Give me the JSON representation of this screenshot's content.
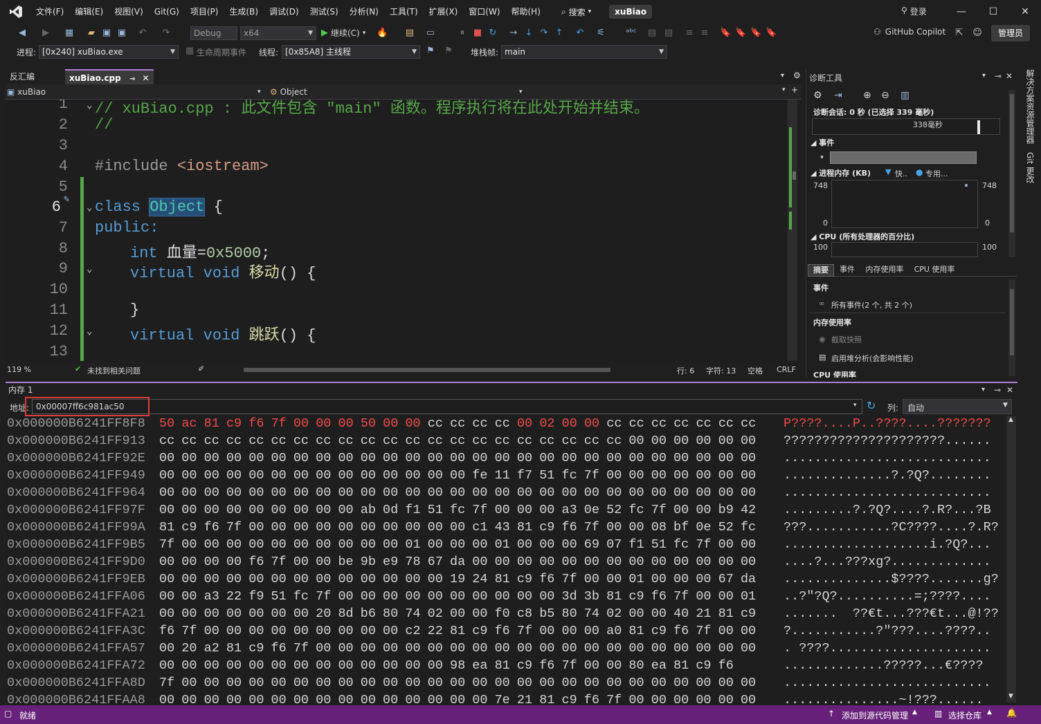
{
  "menu": [
    "文件(F)",
    "编辑(E)",
    "视图(V)",
    "Git(G)",
    "项目(P)",
    "生成(B)",
    "调试(D)",
    "测试(S)",
    "分析(N)",
    "工具(T)",
    "扩展(X)",
    "窗口(W)",
    "帮助(H)"
  ],
  "search_label": "搜索",
  "solution_name": "xuBiao",
  "login_label": "登录",
  "toolbar": {
    "config": "Debug",
    "platform": "x64",
    "continue_label": "继续(C)",
    "copilot_label": "GitHub Copilot",
    "admin_label": "管理员"
  },
  "debugbar": {
    "process_label": "进程:",
    "process_value": "[0x240] xuBiao.exe",
    "lifecycle_label": "生命周期事件",
    "thread_label": "线程:",
    "thread_value": "[0x85A8] 主线程",
    "stack_label": "堆栈帧:",
    "stack_value": "main"
  },
  "editor": {
    "tabs": [
      {
        "label": "反汇编",
        "active": false
      },
      {
        "label": "xuBiao.cpp",
        "active": true
      }
    ],
    "nav_left": "xuBiao",
    "nav_right": "Object",
    "line_numbers": [
      "1",
      "2",
      "3",
      "4",
      "5",
      "6",
      "7",
      "8",
      "9",
      "10",
      "11",
      "12",
      "13"
    ],
    "lines": {
      "l1": "// xuBiao.cpp : 此文件包含 \"main\" 函数。程序执行将在此处开始并结束。",
      "l2": "//",
      "l4a": "#include ",
      "l4b": "<iostream>",
      "l6a": "class ",
      "l6b": "Object",
      "l6c": " {",
      "l7": "public:",
      "l8a": "int",
      "l8b": " 血量=",
      "l8c": "0x5000",
      "l8d": ";",
      "l9a": "virtual",
      "l9b": " void",
      "l9c": " 移动",
      "l9d": "() {",
      "l11": "}",
      "l12a": "virtual",
      "l12b": " void",
      "l12c": " 跳跃",
      "l12d": "() {"
    },
    "zoom": "119 %",
    "issues": "未找到相关问题",
    "row": "行: 6",
    "col": "字符: 13",
    "spaces": "空格",
    "eol": "CRLF"
  },
  "diagnostics": {
    "title": "诊断工具",
    "session": "诊断会话: 0 秒 (已选择 339 毫秒)",
    "timeline_label": "338毫秒",
    "events_title": "事件",
    "memory_title": "进程内存 (KB)",
    "legend_fast": "快..",
    "legend_private": "专用...",
    "mem_max": "748",
    "mem_min": "0",
    "mem_max_r": "748",
    "mem_min_r": "0",
    "cpu_title": "CPU (所有处理器的百分比)",
    "cpu_max": "100",
    "cpu_max_r": "100",
    "tabs": [
      "摘要",
      "事件",
      "内存使用率",
      "CPU 使用率"
    ],
    "summary_events_title": "事件",
    "all_events": "所有事件(2 个, 共 2 个)",
    "mem_usage_title": "内存使用率",
    "snapshot": "截取快照",
    "heap_analysis": "启用堆分析(会影响性能)",
    "cpu_usage_title": "CPU 使用率"
  },
  "vtabs": [
    "解决方案资源管理器",
    "Git 更改"
  ],
  "memory": {
    "title": "内存 1",
    "addr_label": "地址:",
    "addr_value": "0x00007ff6c981ac50",
    "col_label": "列:",
    "col_value": "自动",
    "rows": [
      {
        "addr": "0x000000B6241FF8F8",
        "hex": "50 ac 81 c9 f6 7f 00 00 00 50 00 00 cc cc cc cc 00 02 00 00 cc cc cc cc cc cc cc",
        "ascii": "P????....P..????....???????"
      },
      {
        "addr": "0x000000B6241FF913",
        "hex": "cc cc cc cc cc cc cc cc cc cc cc cc cc cc cc cc cc cc cc cc cc 00 00 00 00 00 00",
        "ascii": "?????????????????????......"
      },
      {
        "addr": "0x000000B6241FF92E",
        "hex": "00 00 00 00 00 00 00 00 00 00 00 00 00 00 00 00 00 00 00 00 00 00 00 00 00 00 00",
        "ascii": "..........................."
      },
      {
        "addr": "0x000000B6241FF949",
        "hex": "00 00 00 00 00 00 00 00 00 00 00 00 00 00 fe 11 f7 51 fc 7f 00 00 00 00 00 00 00",
        "ascii": "..............?.?Q?........"
      },
      {
        "addr": "0x000000B6241FF964",
        "hex": "00 00 00 00 00 00 00 00 00 00 00 00 00 00 00 00 00 00 00 00 00 00 00 00 00 00 00",
        "ascii": "..........................."
      },
      {
        "addr": "0x000000B6241FF97F",
        "hex": "00 00 00 00 00 00 00 00 00 ab 0d f1 51 fc 7f 00 00 00 a3 0e 52 fc 7f 00 00 b9 42",
        "ascii": ".........?.?Q?....?.R?...?B"
      },
      {
        "addr": "0x000000B6241FF99A",
        "hex": "81 c9 f6 7f 00 00 00 00 00 00 00 00 00 00 c1 43 81 c9 f6 7f 00 00 08 bf 0e 52 fc",
        "ascii": "???...........?C????....?.R?"
      },
      {
        "addr": "0x000000B6241FF9B5",
        "hex": "7f 00 00 00 00 00 00 00 00 00 00 01 00 00 00 01 00 00 00 69 07 f1 51 fc 7f 00 00",
        "ascii": "...................i.?Q?..."
      },
      {
        "addr": "0x000000B6241FF9D0",
        "hex": "00 00 00 00 f6 7f 00 00 be 9b e9 78 67 da 00 00 00 00 00 00 00 00 00 00 00 00 00",
        "ascii": "....?...???xg?............."
      },
      {
        "addr": "0x000000B6241FF9EB",
        "hex": "00 00 00 00 00 00 00 00 00 00 00 00 00 19 24 81 c9 f6 7f 00 00 01 00 00 00 67 da",
        "ascii": "..............$????.......g?"
      },
      {
        "addr": "0x000000B6241FFA06",
        "hex": "00 00 a3 22 f9 51 fc 7f 00 00 00 00 00 00 00 00 00 00 3d 3b 81 c9 f6 7f 00 00 01",
        "ascii": "..?\"?Q?..........=;????...."
      },
      {
        "addr": "0x000000B6241FFA21",
        "hex": "00 00 00 00 00 00 00 20 8d b6 80 74 02 00 00 f0 c8 b5 80 74 02 00 00 40 21 81 c9",
        "ascii": ".......  ??€t...???€t...@!??"
      },
      {
        "addr": "0x000000B6241FFA3C",
        "hex": "f6 7f 00 00 00 00 00 00 00 00 00 c2 22 81 c9 f6 7f 00 00 00 a0 81 c9 f6 7f 00 00",
        "ascii": "?...........?\"???....????.."
      },
      {
        "addr": "0x000000B6241FFA57",
        "hex": "00 20 a2 81 c9 f6 7f 00 00 00 00 00 00 00 00 00 00 00 00 00 00 00 00 00 00 00 00",
        "ascii": ". ????....................."
      },
      {
        "addr": "0x000000B6241FFA72",
        "hex": "00 00 00 00 00 00 00 00 00 00 00 00 00 98 ea 81 c9 f6 7f 00 00 80 ea 81 c9 f6",
        "ascii": ".............?????...€????"
      },
      {
        "addr": "0x000000B6241FFA8D",
        "hex": "7f 00 00 00 00 00 00 00 00 00 00 00 00 00 00 00 00 00 00 00 00 00 00 00 00 00 00",
        "ascii": "..........................."
      },
      {
        "addr": "0x000000B6241FFAA8",
        "hex": "00 00 00 00 00 00 00 00 00 00 00 00 00 00 00 7e 21 81 c9 f6 7f 00 00 00 00 00 00",
        "ascii": "...............~!???......"
      }
    ]
  },
  "status": {
    "ready": "就绪",
    "add_source": "添加到源代码管理",
    "select_repo": "选择仓库"
  },
  "colors": {
    "accent": "#68217a",
    "highlight_box": "#e03c3c"
  }
}
